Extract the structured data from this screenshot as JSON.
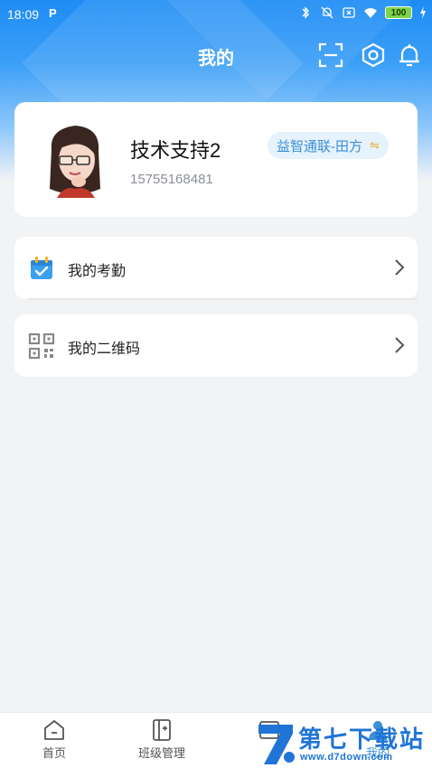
{
  "status_bar": {
    "time": "18:09",
    "battery": "100"
  },
  "header": {
    "title": "我的",
    "icons": [
      "scan-icon",
      "settings-icon",
      "bell-icon"
    ]
  },
  "profile": {
    "name": "技术支持2",
    "phone": "15755168481",
    "org": "益智通联-田方",
    "org_switch_icon": "⇋"
  },
  "menu": [
    {
      "label": "我的考勤",
      "icon": "calendar-check-icon"
    },
    {
      "label": "我的二维码",
      "icon": "qrcode-icon"
    }
  ],
  "bottom_nav": [
    {
      "label": "首页",
      "icon": "home-icon"
    },
    {
      "label": "班级管理",
      "icon": "class-icon"
    },
    {
      "label": "",
      "icon": "card-icon"
    },
    {
      "label": "我的",
      "icon": "user-icon"
    }
  ],
  "watermark": {
    "text": "第七下载站",
    "url": "www.d7down.com"
  },
  "colors": {
    "primary": "#1e8cf5",
    "accent_badge_text": "#3a8fd8",
    "page_bg": "#f2f3f5"
  }
}
